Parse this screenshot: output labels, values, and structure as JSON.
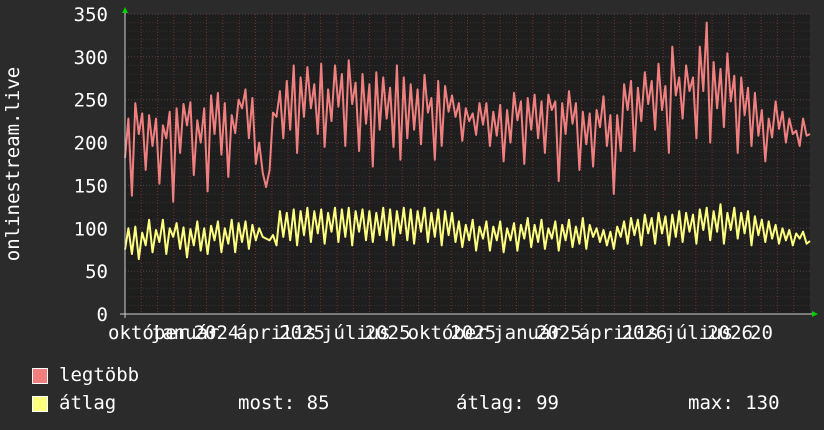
{
  "chart_data": {
    "type": "line",
    "ylabel": "onlinestream.live",
    "ylim": [
      0,
      350
    ],
    "y_ticks": [
      "0",
      "50",
      "100",
      "150",
      "200",
      "250",
      "300",
      "350"
    ],
    "x_tick_labels": [
      "október",
      "január",
      "2024",
      "április",
      "2025",
      "július",
      "2025",
      "október",
      "2025",
      "január",
      "2025",
      "április",
      "2026",
      "július",
      "2026",
      "20"
    ],
    "grid": true,
    "legend_placement": "bottom-left",
    "series": [
      {
        "name": "legtöbb",
        "color": "#f08080",
        "values": [
          182,
          228,
          138,
          246,
          210,
          234,
          168,
          232,
          196,
          228,
          152,
          220,
          205,
          236,
          131,
          240,
          188,
          245,
          220,
          247,
          162,
          226,
          200,
          240,
          143,
          255,
          210,
          258,
          186,
          246,
          160,
          232,
          211,
          250,
          240,
          262,
          205,
          252,
          175,
          200,
          165,
          148,
          168,
          235,
          230,
          260,
          205,
          272,
          215,
          290,
          188,
          276,
          230,
          288,
          240,
          268,
          210,
          292,
          195,
          262,
          225,
          290,
          242,
          280,
          196,
          296,
          245,
          270,
          190,
          280,
          222,
          268,
          172,
          282,
          215,
          276,
          228,
          264,
          195,
          290,
          180,
          276,
          205,
          268,
          215,
          262,
          198,
          279,
          235,
          252,
          180,
          272,
          196,
          266,
          236,
          255,
          230,
          246,
          202,
          240,
          225,
          234,
          209,
          246,
          221,
          246,
          196,
          236,
          208,
          244,
          178,
          238,
          200,
          258,
          226,
          248,
          175,
          252,
          215,
          256,
          205,
          248,
          188,
          256,
          238,
          248,
          155,
          246,
          210,
          260,
          222,
          246,
          168,
          236,
          198,
          234,
          172,
          238,
          218,
          254,
          196,
          232,
          140,
          232,
          190,
          268,
          238,
          272,
          190,
          264,
          225,
          282,
          245,
          272,
          215,
          292,
          238,
          266,
          188,
          312,
          255,
          276,
          228,
          290,
          260,
          276,
          205,
          312,
          260,
          340,
          200,
          294,
          240,
          286,
          218,
          304,
          248,
          278,
          188,
          276,
          232,
          264,
          196,
          258,
          208,
          238,
          178,
          228,
          206,
          248,
          216,
          236,
          200,
          228,
          210,
          214,
          196,
          228,
          208,
          210
        ],
        "stats": {
          "current": "",
          "average": "",
          "max": ""
        }
      },
      {
        "name": "átlag",
        "color": "#ffff80",
        "values": [
          75,
          100,
          70,
          102,
          64,
          95,
          80,
          110,
          72,
          98,
          84,
          110,
          70,
          100,
          90,
          106,
          76,
          101,
          66,
          99,
          80,
          108,
          74,
          100,
          70,
          103,
          86,
          108,
          72,
          100,
          82,
          110,
          72,
          106,
          84,
          108,
          76,
          104,
          86,
          100,
          90,
          88,
          86,
          92,
          80,
          120,
          90,
          118,
          86,
          122,
          80,
          120,
          92,
          124,
          84,
          120,
          94,
          122,
          82,
          118,
          96,
          124,
          84,
          122,
          90,
          124,
          80,
          120,
          96,
          122,
          86,
          120,
          84,
          118,
          92,
          124,
          86,
          122,
          80,
          120,
          94,
          124,
          86,
          122,
          82,
          120,
          96,
          124,
          84,
          118,
          90,
          122,
          80,
          120,
          92,
          118,
          84,
          108,
          78,
          104,
          86,
          110,
          74,
          102,
          88,
          108,
          74,
          102,
          86,
          108,
          72,
          100,
          86,
          106,
          74,
          104,
          88,
          112,
          78,
          104,
          84,
          110,
          76,
          100,
          88,
          108,
          74,
          104,
          86,
          110,
          78,
          102,
          82,
          112,
          76,
          104,
          90,
          100,
          84,
          98,
          80,
          96,
          76,
          102,
          90,
          108,
          82,
          112,
          92,
          110,
          80,
          116,
          94,
          112,
          82,
          118,
          94,
          114,
          80,
          116,
          90,
          120,
          84,
          118,
          96,
          116,
          82,
          122,
          98,
          124,
          86,
          120,
          96,
          128,
          82,
          118,
          98,
          124,
          88,
          118,
          94,
          120,
          80,
          114,
          92,
          110,
          84,
          108,
          88,
          104,
          82,
          100,
          86,
          98,
          80,
          94,
          88,
          96,
          82,
          85
        ],
        "stats": {
          "current": "most: 85",
          "average": "átlag: 99",
          "max": "max: 130"
        }
      }
    ]
  },
  "colors": {
    "background": "#2b2b2b",
    "plot_background": "#1e1e1e",
    "grid_major": "#4a3a3a",
    "grid_minor": "#7a3030",
    "axis": "#d0d0d0",
    "arrow": "#00d000",
    "text": "#ffffff"
  }
}
